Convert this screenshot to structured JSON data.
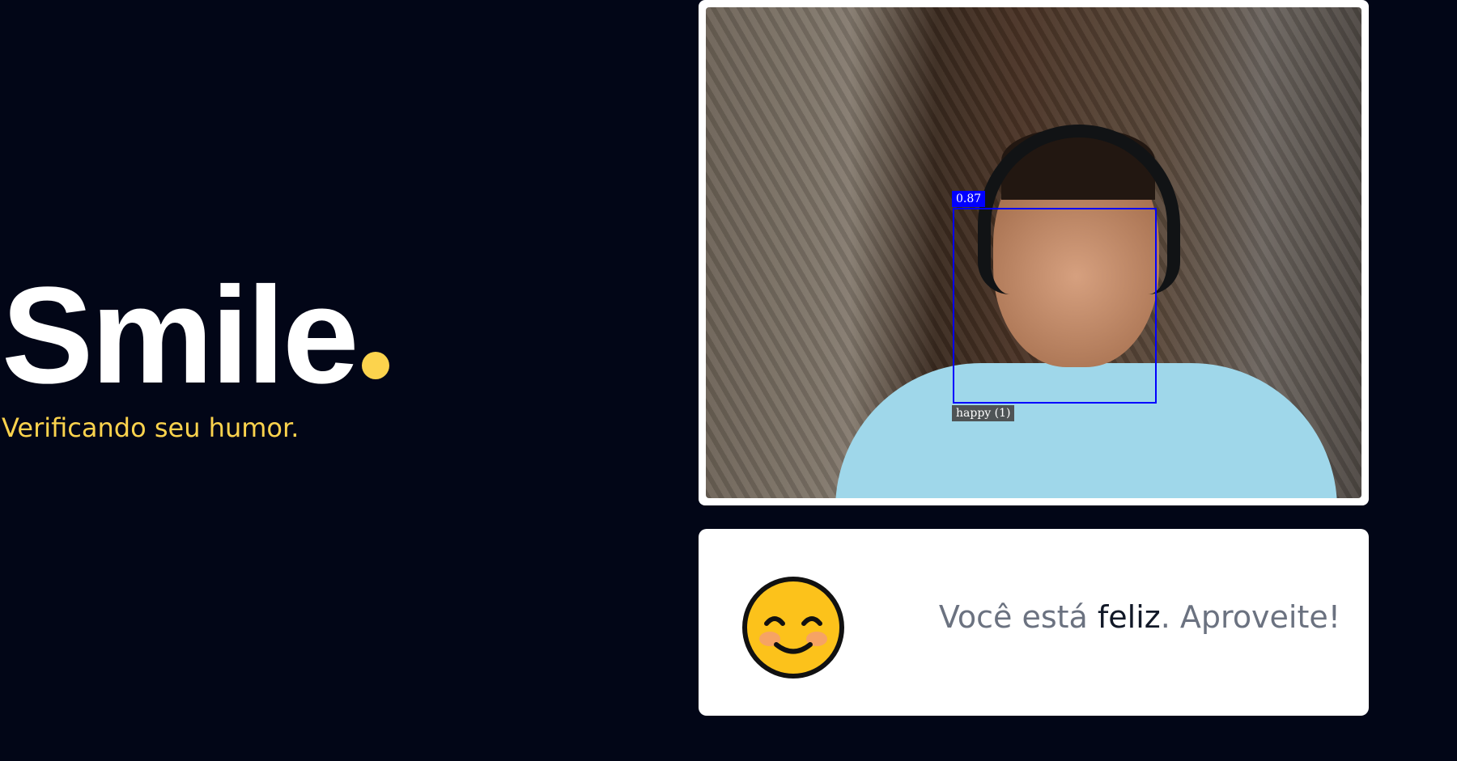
{
  "hero": {
    "title": "Smile",
    "subtitle": "Verificando seu humor.",
    "accent_color": "#fcd34d"
  },
  "camera": {
    "detection": {
      "score": "0.87",
      "emotion_label": "happy (1)"
    }
  },
  "result": {
    "emoji": "smiling-face-icon",
    "text_prefix": "Você está ",
    "mood": "feliz",
    "text_suffix": ". Aproveite!"
  }
}
